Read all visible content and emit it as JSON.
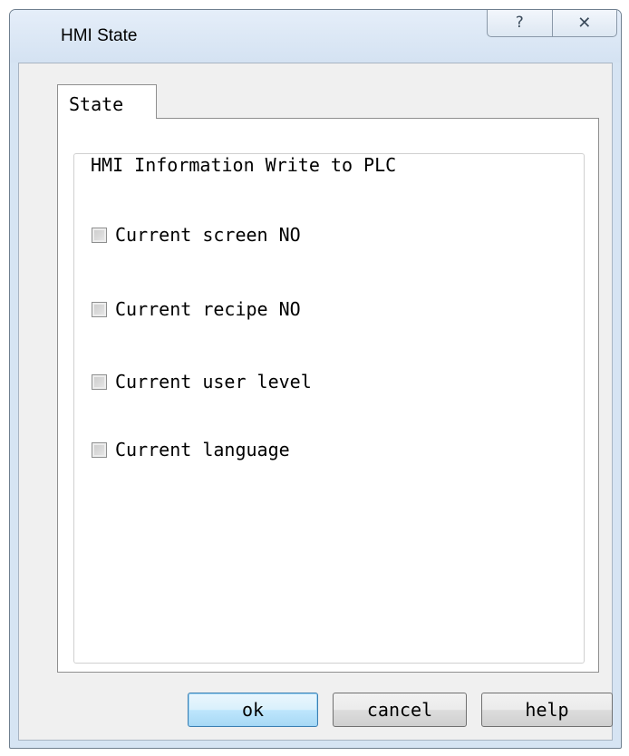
{
  "window": {
    "title": "HMI State",
    "help_glyph": "?",
    "close_glyph": "✕"
  },
  "tabs": [
    {
      "label": "State",
      "selected": true
    }
  ],
  "group": {
    "title": "HMI Information Write to PLC"
  },
  "options": [
    {
      "label": "Current screen NO",
      "checked": false
    },
    {
      "label": "Current recipe NO",
      "checked": false
    },
    {
      "label": "Current user level",
      "checked": false
    },
    {
      "label": "Current language",
      "checked": false
    }
  ],
  "buttons": {
    "ok": "ok",
    "cancel": "cancel",
    "help": "help"
  },
  "colors": {
    "frame": "#d6e4f3",
    "client": "#f0f0f0",
    "default_button": "#bee6fd"
  }
}
